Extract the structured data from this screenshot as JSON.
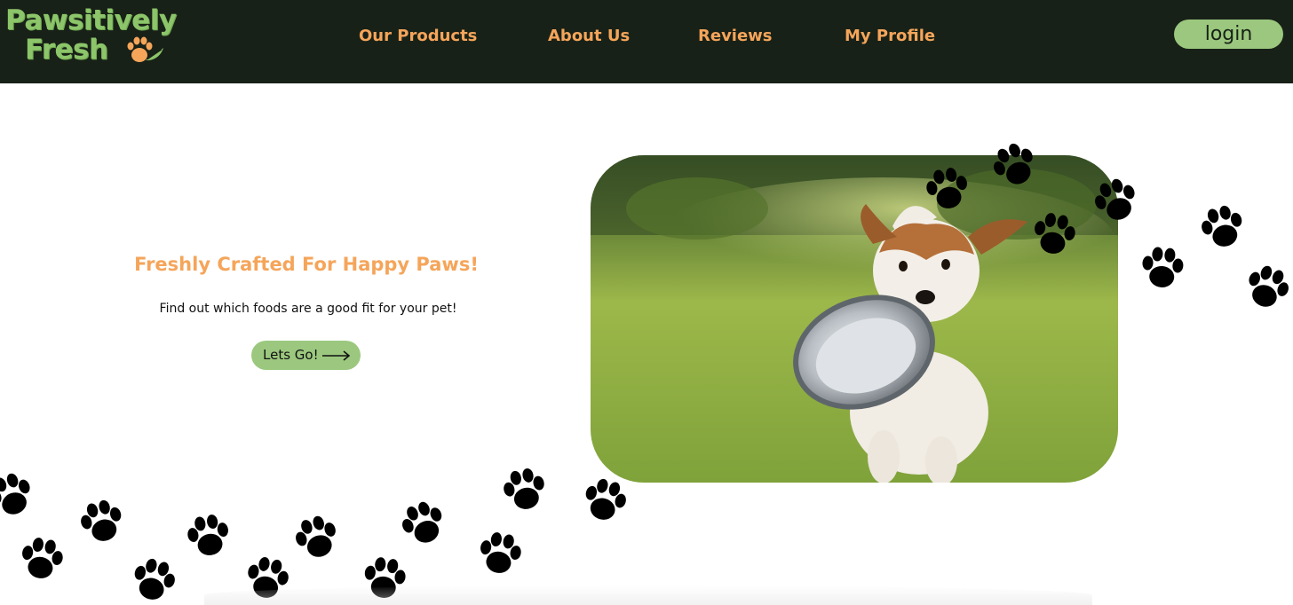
{
  "brand": {
    "line1": "Pawsitively",
    "line2": "Fresh",
    "logo_icon": "paw-leaf-icon"
  },
  "nav": {
    "items": [
      {
        "label": "Our Products"
      },
      {
        "label": "About Us"
      },
      {
        "label": "Reviews"
      },
      {
        "label": "My Profile"
      }
    ],
    "login_label": "login"
  },
  "hero": {
    "title": "Freshly Crafted For Happy Paws!",
    "subtitle": "Find out which foods are a good fit for your pet!",
    "cta_label": "Lets Go!",
    "cta_icon": "long-arrow-right-icon",
    "image_subject": "dog-with-bowl-photo"
  },
  "colors": {
    "header_bg": "#182117",
    "brand_green": "#8cc56a",
    "accent_orange": "#f5a55a",
    "button_green": "#9bc87e",
    "paw_print": "#000000"
  },
  "decor": {
    "paw_icon": "paw-print-icon"
  }
}
